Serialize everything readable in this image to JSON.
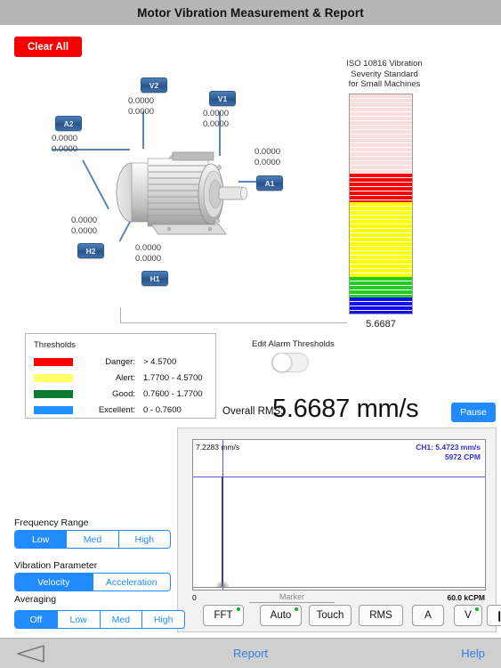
{
  "header": {
    "title": "Motor Vibration Measurement & Report"
  },
  "toolbar": {
    "clear_all_label": "Clear All"
  },
  "motor": {
    "sensors": [
      {
        "id": "V2",
        "label": "V2",
        "values": "0.0000\n0.0000"
      },
      {
        "id": "V1",
        "label": "V1",
        "values": "0.0000\n0.0000"
      },
      {
        "id": "A2",
        "label": "A2",
        "values": "0.0000\n0.0000"
      },
      {
        "id": "A1",
        "label": "A1",
        "values": "0.0000\n0.0000"
      },
      {
        "id": "H2",
        "label": "H2",
        "values": "0.0000\n0.0000"
      },
      {
        "id": "H1",
        "label": "H1",
        "values": "0.0000\n0.0000"
      }
    ]
  },
  "iso": {
    "caption": "ISO 10816 Vibration\nSeverity Standard\nfor Small Machines",
    "value": "5.6687",
    "zones": [
      {
        "name": "inactive-danger",
        "color": "#fadede",
        "from": 0,
        "to": 0.36
      },
      {
        "name": "danger",
        "color": "#fe0000",
        "from": 0.36,
        "to": 0.49
      },
      {
        "name": "alert",
        "color": "#ffff00",
        "from": 0.49,
        "to": 0.835
      },
      {
        "name": "good",
        "color": "#22cc22",
        "from": 0.835,
        "to": 0.925
      },
      {
        "name": "excellent",
        "color": "#1010ee",
        "from": 0.925,
        "to": 1.0
      }
    ]
  },
  "thresholds": {
    "title": "Thresholds",
    "rows": [
      {
        "color": "#fe0000",
        "name": "Danger:",
        "range": "> 4.5700"
      },
      {
        "color": "#ffff66",
        "name": "Alert:",
        "range": "1.7700 - 4.5700"
      },
      {
        "color": "#0a7a33",
        "name": "Good:",
        "range": "0.7600 - 1.7700"
      },
      {
        "color": "#1e90ff",
        "name": "Excellent:",
        "range": "0 - 0.7600"
      }
    ]
  },
  "edit_alarm": {
    "label": "Edit Alarm Thresholds",
    "state": "off"
  },
  "rms": {
    "label": "Overall RMS:",
    "value": "5.6687 mm/s",
    "pause_label": "Pause"
  },
  "chart_data": {
    "type": "line",
    "title": "",
    "xlabel": "",
    "ylabel": "mm/s",
    "y_max_label": "7.2283",
    "y_units": "mm/s",
    "x_min_label": "0",
    "x_max_label": "60.0 kCPM",
    "xlim": [
      0,
      60
    ],
    "ylim": [
      0,
      7.2283
    ],
    "grid": false,
    "legend": "CH1",
    "annotations": {
      "channel": "CH1: 5.4723 mm/s",
      "frequency": "5972 CPM"
    },
    "marker": {
      "x_cpm": 5972,
      "y_mm_s": 5.4723
    },
    "cursor_line_y": 5.4723,
    "series": [
      {
        "name": "CH1",
        "color": "#3a3a9c",
        "x": [
          0,
          0.3,
          1.0,
          2.0,
          3.0,
          4.0,
          5.0,
          5.5,
          5.972,
          6.4,
          7.0,
          9.0,
          13.0,
          20.0,
          30.0,
          40.0,
          50.0,
          60.0
        ],
        "y": [
          0.3,
          0.12,
          0.04,
          0.03,
          0.03,
          0.03,
          0.05,
          0.3,
          5.4723,
          0.3,
          0.05,
          0.03,
          0.03,
          0.02,
          0.02,
          0.02,
          0.02,
          0.02
        ]
      }
    ],
    "marker_caption": "Marker"
  },
  "plot_buttons": [
    {
      "label": "FFT",
      "indicator": true
    },
    {
      "label": "Auto",
      "indicator": true
    },
    {
      "label": "Touch",
      "indicator": false
    },
    {
      "label": "RMS",
      "indicator": false
    },
    {
      "label": "A",
      "indicator": false
    },
    {
      "label": "V",
      "indicator": true
    },
    {
      "label": "❙❙",
      "indicator": false
    }
  ],
  "controls": [
    {
      "title": "Frequency Range",
      "options": [
        "Low",
        "Med",
        "High"
      ],
      "selected": 0
    },
    {
      "title": "Vibration Parameter",
      "options": [
        "Velocity",
        "Acceleration"
      ],
      "selected": 0
    },
    {
      "title": "Averaging",
      "options": [
        "Off",
        "Low",
        "Med",
        "High"
      ],
      "selected": 0
    }
  ],
  "bottom": {
    "back_icon": "back-triangle-icon",
    "center_label": "Report",
    "help_label": "Help"
  }
}
